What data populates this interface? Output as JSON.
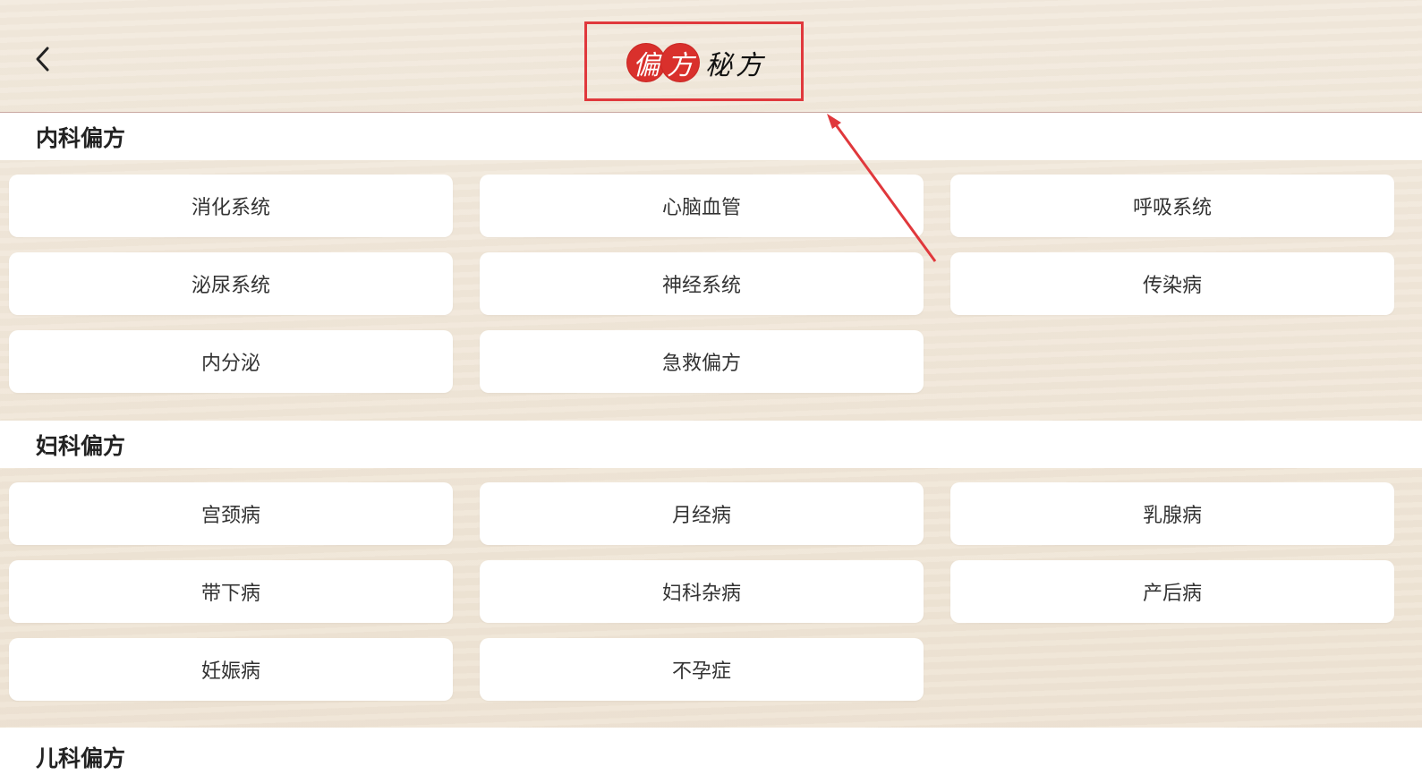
{
  "header": {
    "back_icon": "chevron-left-icon",
    "title_seal_chars": [
      "偏",
      "方"
    ],
    "title_brush_text": "秘方",
    "highlight_color": "#e0383c",
    "seal_color": "#d9302c"
  },
  "sections": [
    {
      "title": "内科偏方",
      "items": [
        "消化系统",
        "心脑血管",
        "呼吸系统",
        "泌尿系统",
        "神经系统",
        "传染病",
        "内分泌",
        "急救偏方"
      ]
    },
    {
      "title": "妇科偏方",
      "items": [
        "宫颈病",
        "月经病",
        "乳腺病",
        "带下病",
        "妇科杂病",
        "产后病",
        "妊娠病",
        "不孕症"
      ]
    },
    {
      "title": "儿科偏方",
      "items": []
    }
  ]
}
